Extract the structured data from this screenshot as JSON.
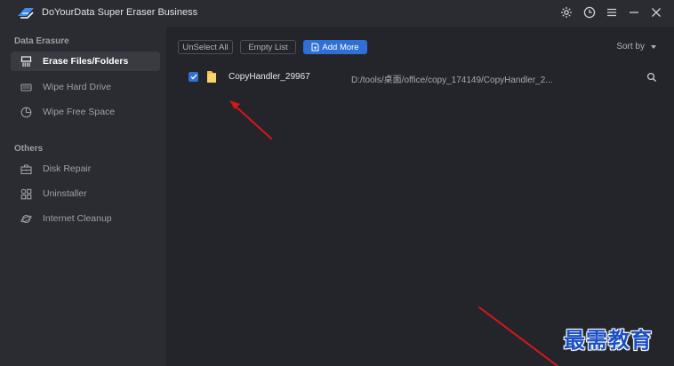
{
  "app": {
    "title": "DoYourData Super Eraser Business"
  },
  "title_icons": [
    "gear-icon",
    "clock-icon",
    "menu-icon",
    "minimize-icon",
    "close-icon"
  ],
  "sidebar": {
    "sections": [
      {
        "title": "Data Erasure",
        "items": [
          {
            "label": "Erase Files/Folders",
            "icon": "shredder-icon",
            "active": true
          },
          {
            "label": "Wipe Hard Drive",
            "icon": "hard-drive-icon",
            "active": false
          },
          {
            "label": "Wipe Free Space",
            "icon": "pie-icon",
            "active": false
          }
        ]
      },
      {
        "title": "Others",
        "items": [
          {
            "label": "Disk Repair",
            "icon": "toolbox-icon",
            "active": false
          },
          {
            "label": "Uninstaller",
            "icon": "apps-grid-icon",
            "active": false
          },
          {
            "label": "Internet Cleanup",
            "icon": "planet-icon",
            "active": false
          }
        ]
      }
    ]
  },
  "toolbar": {
    "unselect_all": "UnSelect All",
    "empty_list": "Empty List",
    "add_more": "Add More",
    "sort_by": "Sort by"
  },
  "files": [
    {
      "checked": true,
      "name": "CopyHandler_29967",
      "path": "D:/tools/桌面/office/copy_174149/CopyHandler_2..."
    }
  ],
  "colors": {
    "accent": "#2f6fd6",
    "sidebar_bg": "#2b2c32",
    "main_bg": "#24252b",
    "arrow": "#d8161b",
    "watermark": "#1b4fc4"
  },
  "watermark": "最需教育"
}
